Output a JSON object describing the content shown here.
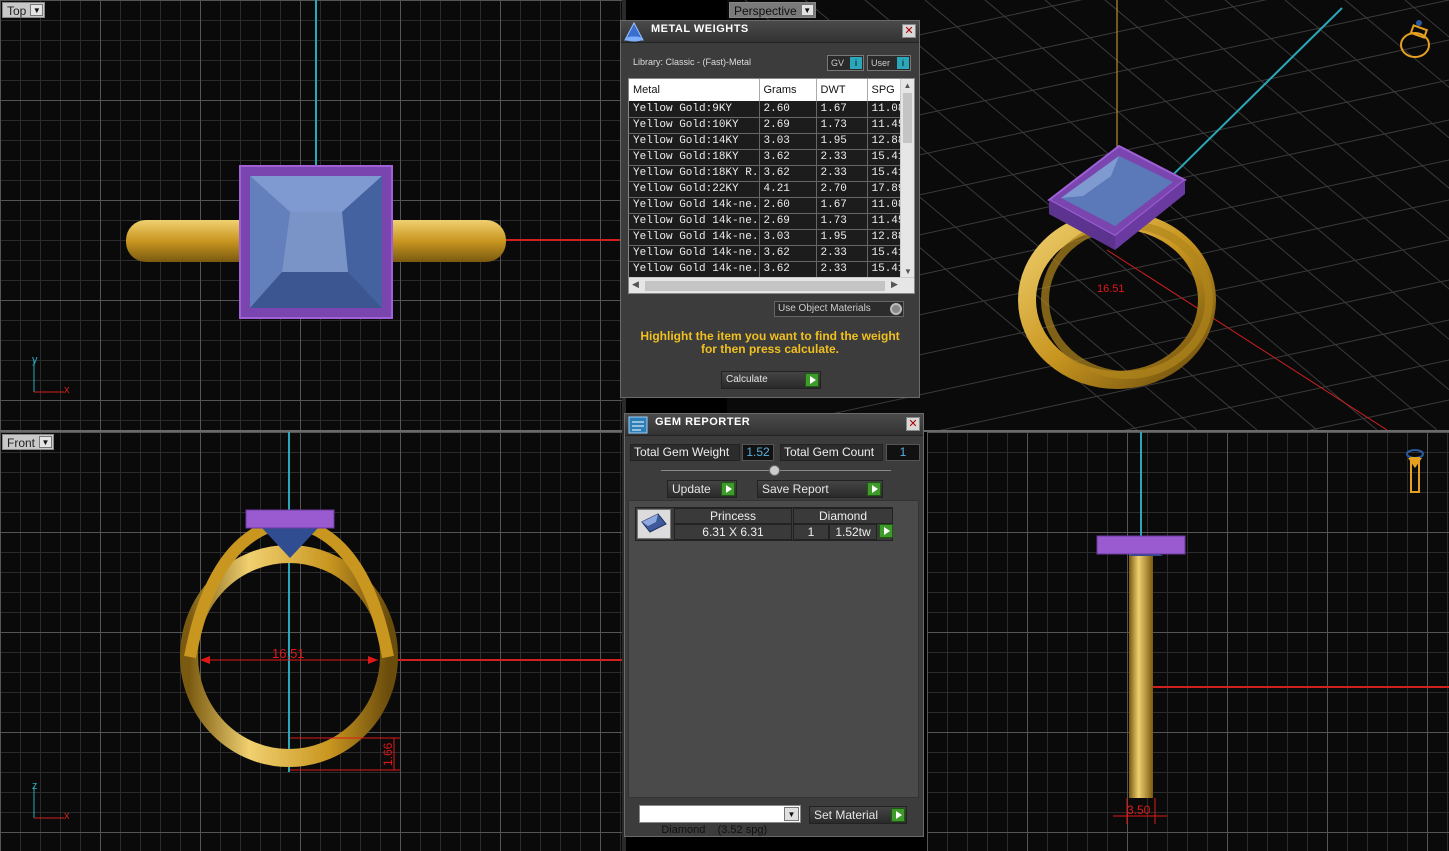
{
  "viewports": {
    "top": {
      "label": "Top",
      "axis_y": "y",
      "axis_x": "x"
    },
    "perspective": {
      "label": "Perspective",
      "dimension_label": "16.51"
    },
    "front": {
      "label": "Front",
      "axis_z": "z",
      "axis_x": "x",
      "dimension_width": "16.51",
      "dimension_height": "1.66"
    },
    "side": {
      "dimension_label": "3.50"
    }
  },
  "metal_weights": {
    "title": "METAL WEIGHTS",
    "library": "Library: Classic - (Fast)-Metal",
    "gv_label": "GV",
    "user_label": "User",
    "columns": [
      "Metal",
      "Grams",
      "DWT",
      "SPG"
    ],
    "rows": [
      {
        "metal": "Yellow Gold:9KY",
        "grams": "2.60",
        "dwt": "1.67",
        "spg": "11.08"
      },
      {
        "metal": "Yellow Gold:10KY",
        "grams": "2.69",
        "dwt": "1.73",
        "spg": "11.45"
      },
      {
        "metal": "Yellow Gold:14KY",
        "grams": "3.03",
        "dwt": "1.95",
        "spg": "12.88"
      },
      {
        "metal": "Yellow Gold:18KY",
        "grams": "3.62",
        "dwt": "2.33",
        "spg": "15.41"
      },
      {
        "metal": "Yellow Gold:18KY R...",
        "grams": "3.62",
        "dwt": "2.33",
        "spg": "15.41"
      },
      {
        "metal": "Yellow Gold:22KY",
        "grams": "4.21",
        "dwt": "2.70",
        "spg": "17.89"
      },
      {
        "metal": "Yellow Gold 14k-ne...",
        "grams": "2.60",
        "dwt": "1.67",
        "spg": "11.08"
      },
      {
        "metal": "Yellow Gold 14k-ne...",
        "grams": "2.69",
        "dwt": "1.73",
        "spg": "11.45"
      },
      {
        "metal": "Yellow Gold 14k-ne...",
        "grams": "3.03",
        "dwt": "1.95",
        "spg": "12.88"
      },
      {
        "metal": "Yellow Gold 14k-ne...",
        "grams": "3.62",
        "dwt": "2.33",
        "spg": "15.41"
      },
      {
        "metal": "Yellow Gold 14k-ne...",
        "grams": "3.62",
        "dwt": "2.33",
        "spg": "15.41"
      }
    ],
    "use_object_materials": "Use Object Materials",
    "instruction": "Highlight the item you want to find the weight for then press calculate.",
    "calculate_label": "Calculate"
  },
  "gem_reporter": {
    "title": "GEM REPORTER",
    "total_weight_label": "Total Gem Weight",
    "total_weight_value": "1.52",
    "total_count_label": "Total Gem Count",
    "total_count_value": "1",
    "update_label": "Update",
    "save_report_label": "Save Report",
    "gem": {
      "cut": "Princess",
      "size": "6.31 X 6.31",
      "material": "Diamond",
      "count": "1",
      "weight": "1.52tw"
    },
    "material_select": "Diamond    (3.52 spg)",
    "set_material_label": "Set Material"
  },
  "colors": {
    "gold": "#d9a830",
    "bezel": "#8a4fc0",
    "gem": "#5a7ab8",
    "dim_red": "#e01818",
    "axis_teal": "#2aa7b8"
  }
}
